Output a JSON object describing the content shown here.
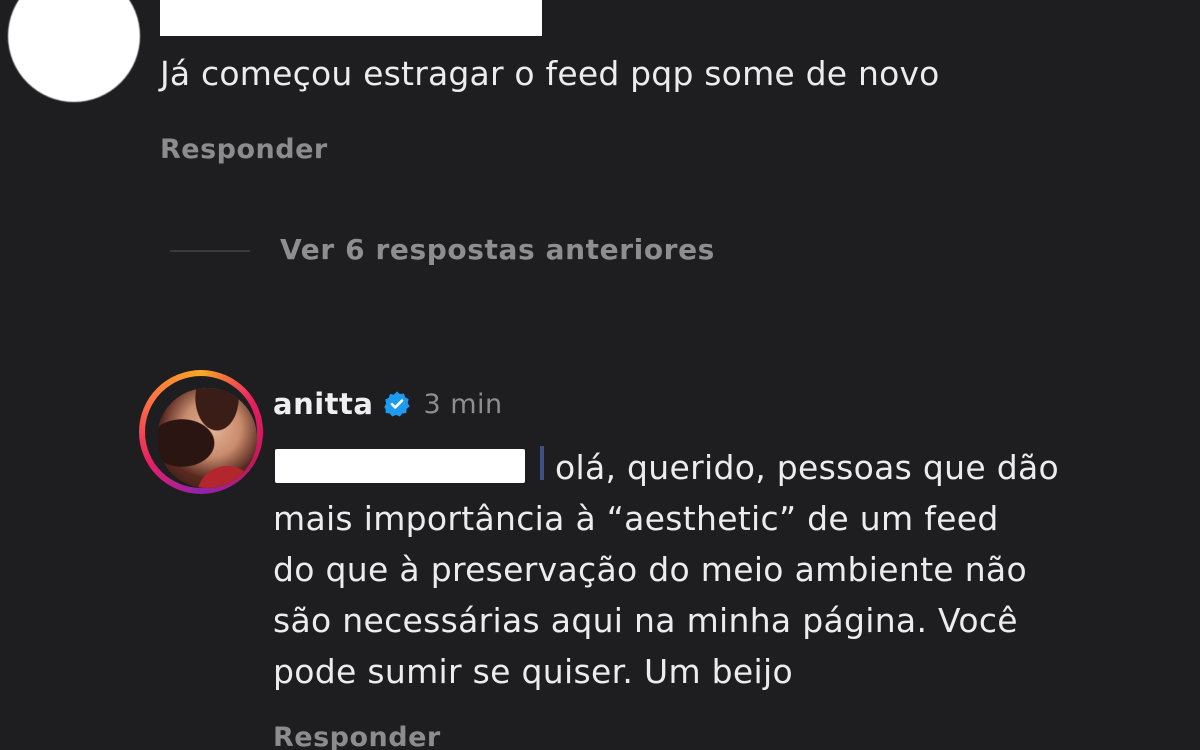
{
  "first_comment": {
    "text": "Já começou estragar o feed pqp some de novo",
    "reply_label": "Responder"
  },
  "view_replies": {
    "label": "Ver 6 respostas anteriores"
  },
  "reply_comment": {
    "username": "anitta",
    "verified_icon": "verified-badge-icon",
    "timestamp": "3 min",
    "lines": [
      "olá, querido, pessoas que dão",
      "mais importância à “aesthetic” de um feed",
      "do que à preservação do meio ambiente não",
      "são necessárias aqui na minha página. Você",
      "pode sumir se quiser. Um beijo"
    ],
    "reply_label": "Responder"
  },
  "colors": {
    "background": "#1e1e20",
    "text": "#ececec",
    "muted": "#8e8e91",
    "verified": "#1d9bf0",
    "mention": "#5a7bd8"
  }
}
